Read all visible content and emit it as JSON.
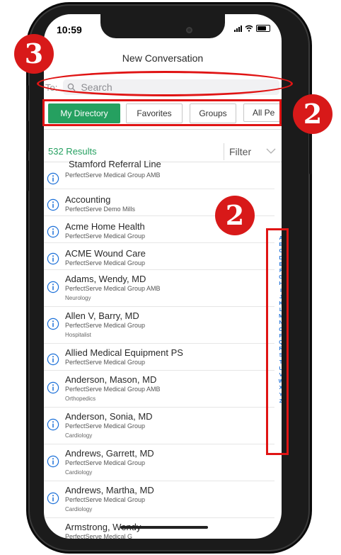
{
  "status_bar": {
    "time": "10:59"
  },
  "header": {
    "title": "New Conversation"
  },
  "search": {
    "to_label": "To:",
    "placeholder": "Search"
  },
  "tabs": [
    {
      "label": "My Directory",
      "active": true
    },
    {
      "label": "Favorites",
      "active": false
    },
    {
      "label": "Groups",
      "active": false
    },
    {
      "label": "All Pe",
      "active": false
    }
  ],
  "results": {
    "count_text": "532 Results",
    "filter_label": "Filter"
  },
  "contacts": [
    {
      "name": "Stamford Referral Line",
      "org": "PerfectServe Medical Group AMB",
      "specialty": ""
    },
    {
      "name": "Accounting",
      "org": "PerfectServe Demo Mills",
      "specialty": ""
    },
    {
      "name": "Acme Home Health",
      "org": "PerfectServe Medical Group",
      "specialty": ""
    },
    {
      "name": "ACME Wound Care",
      "org": "PerfectServe Medical Group",
      "specialty": ""
    },
    {
      "name": "Adams, Wendy, MD",
      "org": "PerfectServe Medical Group AMB",
      "specialty": "Neurology"
    },
    {
      "name": "Allen V, Barry, MD",
      "org": "PerfectServe Medical Group",
      "specialty": "Hospitalist"
    },
    {
      "name": "Allied Medical Equipment PS",
      "org": "PerfectServe Medical Group",
      "specialty": ""
    },
    {
      "name": "Anderson, Mason, MD",
      "org": "PerfectServe Medical Group AMB",
      "specialty": "Orthopedics"
    },
    {
      "name": "Anderson, Sonia, MD",
      "org": "PerfectServe Medical Group",
      "specialty": "Cardiology"
    },
    {
      "name": "Andrews, Garrett, MD",
      "org": "PerfectServe Medical Group",
      "specialty": "Cardiology"
    },
    {
      "name": "Andrews, Martha, MD",
      "org": "PerfectServe Medical Group",
      "specialty": "Cardiology"
    },
    {
      "name": "Armstrong, Wendy",
      "org": "PerfectServe Medical G",
      "specialty": ""
    }
  ],
  "alphabet_index": [
    "A",
    "B",
    "C",
    "D",
    "E",
    "F",
    "G",
    "H",
    "I",
    "J",
    "K",
    "L",
    "M",
    "N",
    "O",
    "P",
    "Q",
    "R",
    "S",
    "T",
    "U",
    "V",
    "W",
    "X",
    "Y",
    "Z"
  ],
  "callouts": {
    "search_number": "3",
    "tabs_number": "2",
    "index_number": "2"
  },
  "colors": {
    "accent": "#25a060",
    "annotation": "#e01414",
    "index_link": "#1a6fd8",
    "info_icon": "#1a6fd8"
  },
  "icons": {
    "search": "search-icon",
    "info": "info-icon",
    "filter": "chevron-down-icon"
  }
}
